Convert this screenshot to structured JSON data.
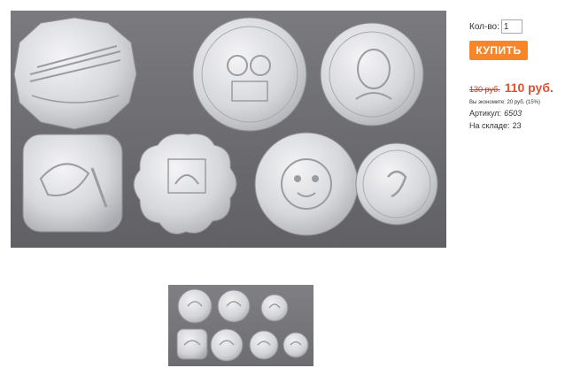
{
  "product": {
    "qty_label": "Кол-во:",
    "qty_value": "1",
    "buy_label": "КУПИТЬ",
    "old_price": "130 руб.",
    "new_price": "110 руб.",
    "savings": "Вы экономите: 20 руб. (15%)",
    "article_label": "Артикул:",
    "article_value": "6503",
    "stock_label": "На складе:",
    "stock_value": "23"
  },
  "colors": {
    "buy_button": "#f7852a",
    "new_price": "#e0522f",
    "old_price": "#c0392b"
  }
}
